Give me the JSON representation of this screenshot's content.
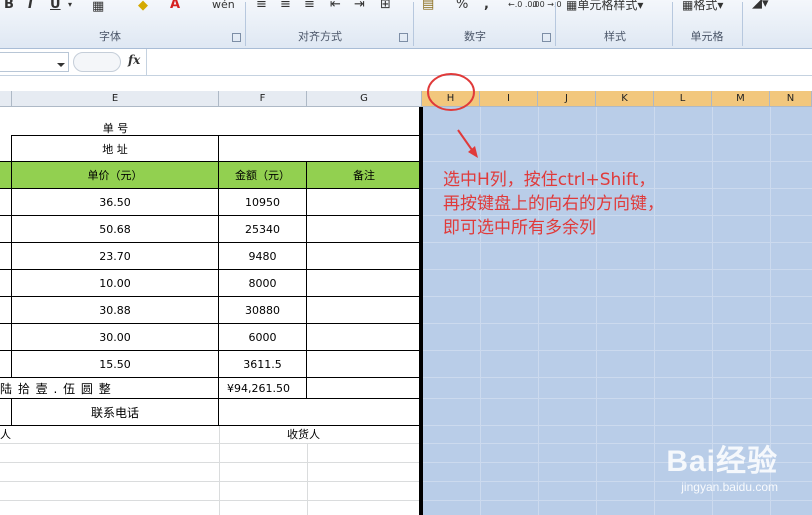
{
  "ribbon": {
    "buttons": {
      "bold": "B",
      "italic": "I",
      "underline": "U",
      "font_color": "A",
      "phonetic": "wén",
      "percent": "%",
      "comma": ",",
      "inc_decimal": "←.0 .00",
      "dec_decimal": ".00 →.0",
      "cell_style": "单元格样式",
      "format": "格式"
    },
    "groups": {
      "font": "字体",
      "alignment": "对齐方式",
      "number": "数字",
      "styles": "样式",
      "cells": "单元格"
    }
  },
  "formula_bar": {
    "fx": "fx",
    "value": ""
  },
  "columns": [
    {
      "letter": "E",
      "selected": false
    },
    {
      "letter": "F",
      "selected": false
    },
    {
      "letter": "G",
      "selected": false
    },
    {
      "letter": "H",
      "selected": true
    },
    {
      "letter": "I",
      "selected": true
    },
    {
      "letter": "J",
      "selected": true
    },
    {
      "letter": "K",
      "selected": true
    },
    {
      "letter": "L",
      "selected": true
    },
    {
      "letter": "M",
      "selected": true
    },
    {
      "letter": "N",
      "selected": true
    }
  ],
  "sheet": {
    "title": "单 号",
    "address": "地      址",
    "headers": {
      "unit_price": "单价（元）",
      "amount": "金额（元）",
      "note": "备注"
    },
    "rows": [
      {
        "price": "36.50",
        "amount": "10950"
      },
      {
        "price": "50.68",
        "amount": "25340"
      },
      {
        "price": "23.70",
        "amount": "9480"
      },
      {
        "price": "10.00",
        "amount": "8000"
      },
      {
        "price": "30.88",
        "amount": "30880"
      },
      {
        "price": "30.00",
        "amount": "6000"
      },
      {
        "price": "15.50",
        "amount": "3611.5"
      }
    ],
    "total_words": "陆 拾 壹 . 伍 圆 整",
    "total_amount": "¥94,261.50",
    "contact_phone": "联系电话",
    "signer_left": "人",
    "receiver": "收货人"
  },
  "annotation": {
    "line1": "选中H列，按住ctrl+Shift，",
    "line2": "再按键盘上的向右的方向键，",
    "line3": "即可选中所有多余列"
  },
  "colors": {
    "accent_red": "#e03a3a",
    "header_green": "#92d050",
    "selection_blue": "#b9cde8",
    "selected_header": "#f2c77d"
  },
  "watermark": {
    "logo": "Bai经验",
    "url": "jingyan.baidu.com"
  }
}
